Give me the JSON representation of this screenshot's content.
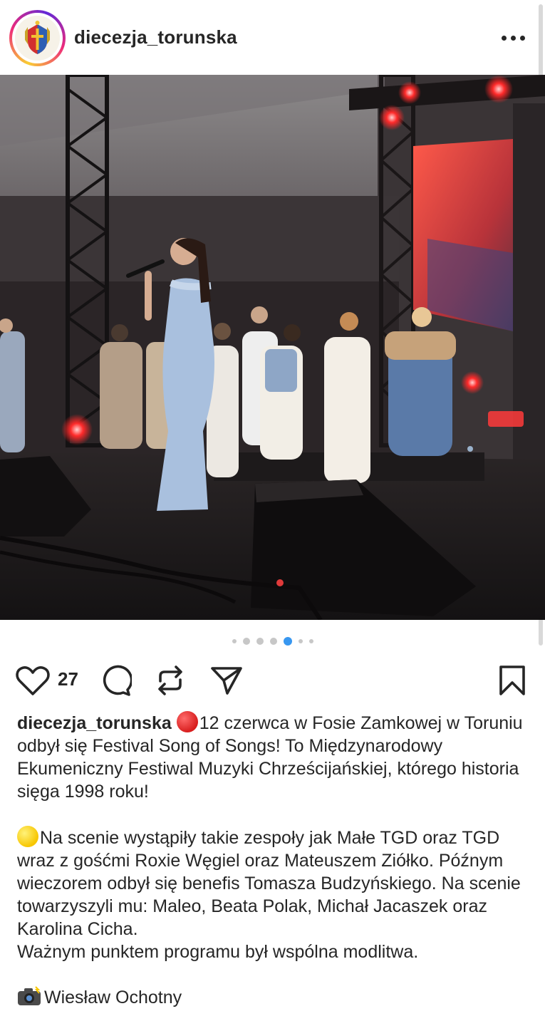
{
  "post": {
    "username": "diecezja_torunska",
    "likes_count": "27",
    "carousel": {
      "total": 6,
      "active_index": 3
    },
    "caption": {
      "username": "diecezja_torunska",
      "paragraph1": "12 czerwca w Fosie Zamkowej w Toruniu odbył się Festival Song of Songs! To Międzynarodowy Ekumeniczny Festiwal Muzyki Chrześcijańskiej, którego historia sięga 1998 roku!",
      "paragraph2": "Na scenie wystąpiły takie zespoły jak Małe TGD oraz TGD wraz z gośćmi Roxie Węgiel oraz Mateuszem Ziółko. Późnym wieczorem odbył się benefis Tomasza Budzyńskiego. Na scenie towarzyszyli mu: Maleo, Beata Polak, Michał Jacaszek oraz Karolina Cicha.",
      "paragraph3": "Ważnym punktem programu był wspólna modlitwa.",
      "credit": "Wiesław Ochotny"
    }
  },
  "icons": {
    "more": "more-horizontal-icon",
    "like": "heart-icon",
    "comment": "comment-icon",
    "repost": "repost-icon",
    "share": "send-icon",
    "save": "bookmark-icon"
  },
  "colors": {
    "text": "#262626",
    "active_dot": "#3897f0",
    "inactive_dot": "#c7c7c7"
  }
}
